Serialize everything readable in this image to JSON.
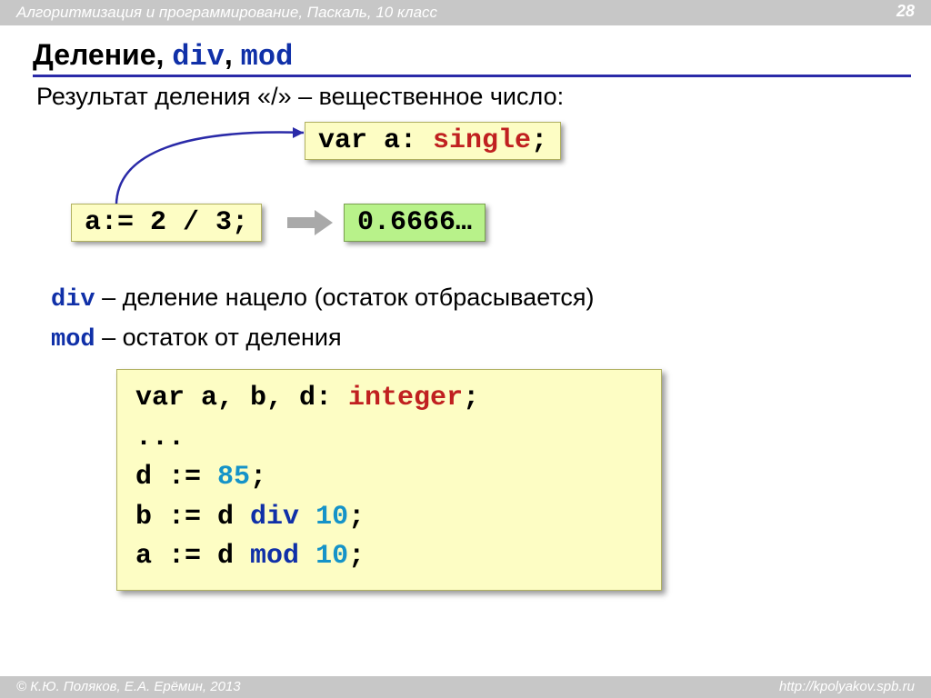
{
  "header": {
    "course": "Алгоритмизация и программирование, Паскаль, 10 класс",
    "page": "28"
  },
  "title": {
    "text": "Деление,",
    "kw1": "div",
    "sep": ",",
    "kw2": "mod"
  },
  "subtitle": "Результат деления «/» – вещественное число:",
  "boxes": {
    "var_decl_pre": "var a: ",
    "var_decl_type": "single",
    "var_decl_post": ";",
    "assign": "a:= 2 / 3;",
    "result": "0.6666…"
  },
  "defs": {
    "div_kw": "div",
    "div_txt": " – деление нацело (остаток отбрасывается)",
    "mod_kw": "mod",
    "mod_txt": " – остаток от деления"
  },
  "code": {
    "l1a": "var a, b, d: ",
    "l1b": "integer",
    "l1c": ";",
    "l2": "...",
    "l3a": "d := ",
    "l3b": "85",
    "l3c": ";",
    "l4a": "b := d ",
    "l4b": "div",
    "l4c": " ",
    "l4d": "10",
    "l4e": ";",
    "l5a": "a := d ",
    "l5b": "mod",
    "l5c": " ",
    "l5d": "10",
    "l5e": ";"
  },
  "footer": {
    "left": "© К.Ю. Поляков, Е.А. Ерёмин, 2013",
    "right": "http://kpolyakov.spb.ru"
  }
}
